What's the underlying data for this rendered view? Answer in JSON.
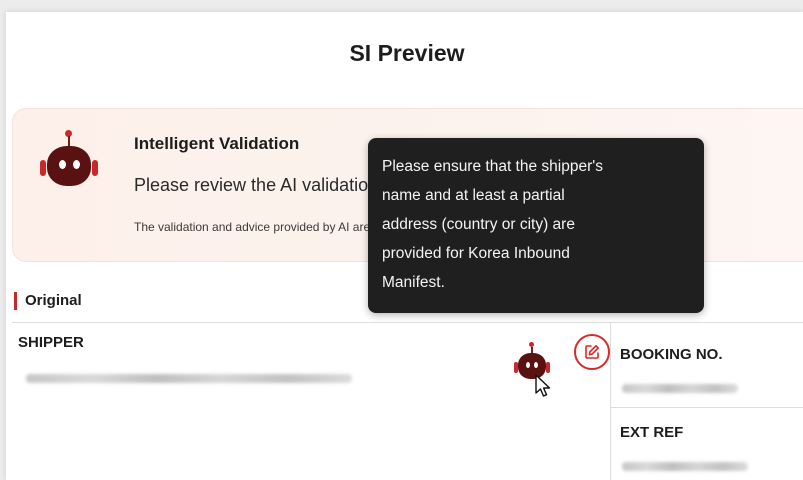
{
  "page": {
    "title": "SI Preview"
  },
  "banner": {
    "icon": "robot-icon",
    "title": "Intelligent Validation",
    "message": "Please review the AI validation results for reference as you need.",
    "note": "The validation and advice provided by AI are for reference only"
  },
  "tooltip": {
    "lines": [
      "Please ensure that the shipper's",
      "name and at least a partial",
      "address (country or city) are",
      "provided for Korea Inbound",
      "Manifest."
    ]
  },
  "section": {
    "label": "Original"
  },
  "fields": {
    "shipper_label": "SHIPPER",
    "booking_label": "BOOKING NO.",
    "ext_ref_label": "EXT REF"
  },
  "icons": {
    "ai_validation": "robot-icon",
    "edit": "edit-icon",
    "cursor": "mouse-cursor-icon"
  },
  "colors": {
    "accent": "#c7282a",
    "robot_head": "#5a1111",
    "tooltip_bg": "#1f1f1f",
    "banner_bg": "#fdf0ea"
  }
}
